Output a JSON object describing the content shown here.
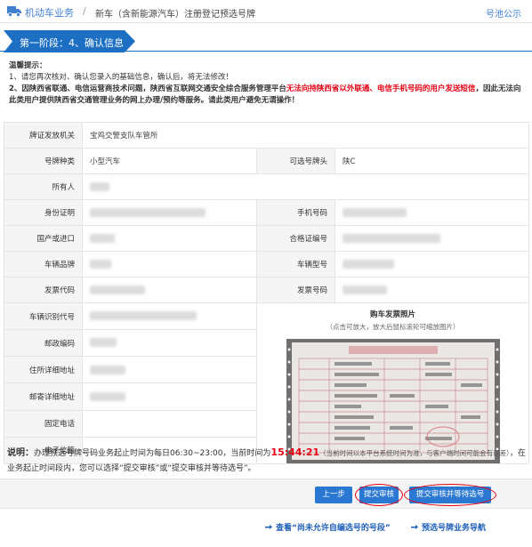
{
  "topbar": {
    "section": "机动车业务",
    "separator": "/",
    "crumb": "新车（含新能源汽车）注册登记预选号牌",
    "notice": "号池公示"
  },
  "stage": {
    "label": "第一阶段：4、确认信息"
  },
  "tips": {
    "title": "温馨提示：",
    "line1": "1、请您再次核对、确认您录入的基础信息，确认后，将无法修改！",
    "line2_a": "2、因陕西省联通、电信运营商技术问题，陕西省互联网交通安全综合服务管理平台",
    "line2_red": "无法向持陕西省以外联通、电信手机号码的用户发送短信",
    "line2_b": "，因此无法向此类用户提供陕西省交通管理业务的网上办理/预约等服务。请此类用户避免无谓操作！"
  },
  "form": {
    "issuer_label": "牌证发放机关",
    "issuer_value": "宝鸡交警支队车管所",
    "plate_type_label": "号牌种类",
    "plate_type_value": "小型汽车",
    "plate_prefix_label": "可选号牌头",
    "plate_prefix_value": "陕C",
    "owner_label": "所有人",
    "id_label": "身份证明",
    "phone_label": "手机号码",
    "origin_label": "国产或进口",
    "cert_label": "合格证编号",
    "brand_label": "车辆品牌",
    "model_label": "车辆型号",
    "invoice_code_label": "发票代码",
    "invoice_no_label": "发票号码",
    "vin_label": "车辆识别代号",
    "postcode_label": "邮政编码",
    "address_label": "住所详细地址",
    "mail_address_label": "邮寄详细地址",
    "landline_label": "固定电话",
    "email_label": "电子信箱",
    "photo_title": "购车发票照片",
    "photo_hint": "（点击可放大，放大后鼠标滚轮可缩放图片）"
  },
  "note": {
    "lead": "说明：",
    "text_a": "办理预选号牌号码业务起止时间为每日06:30~23:00，当前时间为",
    "time": "15:44:21",
    "text_small": "（当前时间以本平台系统时间为准，与客户端时间可能会有误差）",
    "text_b": "，在业务起止时间段内，您可以选择“提交审核”或“提交审核并等待选号”。"
  },
  "actions": {
    "prev": "上一步",
    "submit": "提交审核",
    "submit_wait": "提交审核并等待选号"
  },
  "links": {
    "check": "查看“尚未允许自编选号的号段”",
    "guide": "预选号牌业务导航"
  },
  "colors": {
    "accent": "#2a78d2",
    "stage": "#1d6fc4",
    "warning": "#e60012"
  }
}
